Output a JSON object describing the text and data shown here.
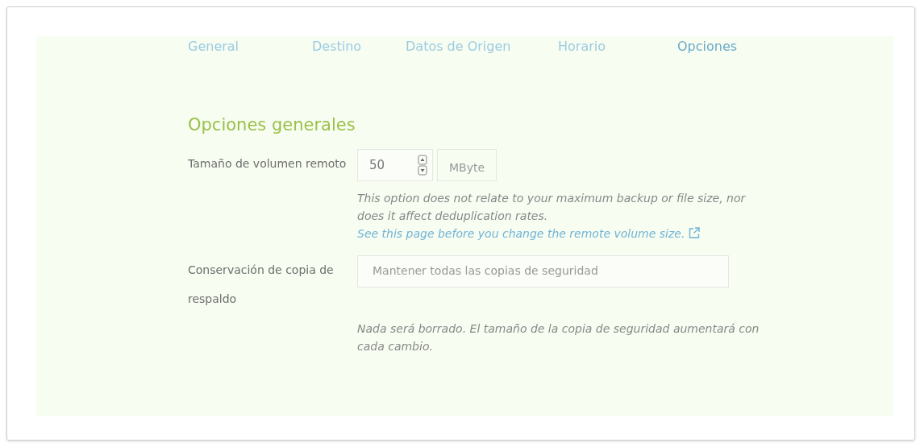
{
  "tabs": [
    {
      "label": "General",
      "selected": false
    },
    {
      "label": "Destino",
      "selected": false
    },
    {
      "label": "Datos de Origen",
      "selected": false
    },
    {
      "label": "Horario",
      "selected": false
    },
    {
      "label": "Opciones",
      "selected": true
    }
  ],
  "section_title": "Opciones generales",
  "fields": [
    {
      "kind": "number",
      "label": "Tamaño de volumen remoto",
      "value": "50",
      "unit": "MByte",
      "help": "This option does not relate to your maximum backup or file size, nor does it affect deduplication rates.",
      "help_link": "See this page before you change the remote volume size."
    },
    {
      "kind": "select",
      "label": "Conservación de copia de respaldo",
      "value": "Mantener todas las copias de seguridad",
      "help": "Nada será borrado. El tamaño de la copia de seguridad aumentará con cada cambio."
    }
  ]
}
